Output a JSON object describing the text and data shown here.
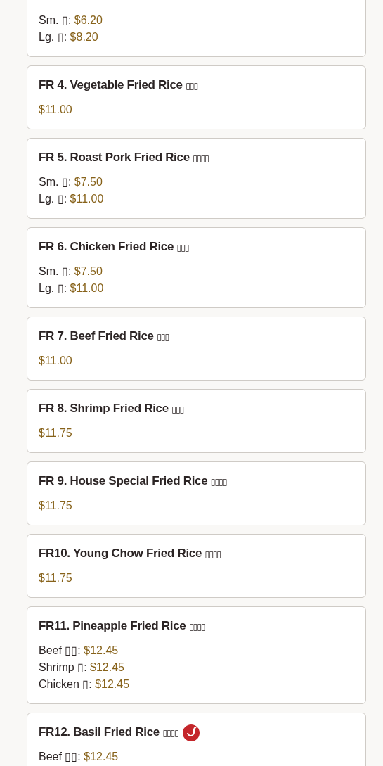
{
  "menu_items": [
    {
      "prices": [
        {
          "label": "Sm. ▯:",
          "price": "$6.20"
        },
        {
          "label": "Lg. ▯:",
          "price": "$8.20"
        }
      ]
    },
    {
      "title": "FR 4. Vegetable Fried Rice",
      "chinese": "▯▯▯",
      "spicy": false,
      "prices": [
        {
          "price": "$11.00"
        }
      ]
    },
    {
      "title": "FR 5. Roast Pork Fried Rice",
      "chinese": "▯▯▯▯",
      "spicy": false,
      "prices": [
        {
          "label": "Sm. ▯:",
          "price": "$7.50"
        },
        {
          "label": "Lg. ▯:",
          "price": "$11.00"
        }
      ]
    },
    {
      "title": "FR 6. Chicken Fried Rice",
      "chinese": "▯▯▯",
      "spicy": false,
      "prices": [
        {
          "label": "Sm. ▯:",
          "price": "$7.50"
        },
        {
          "label": "Lg. ▯:",
          "price": "$11.00"
        }
      ]
    },
    {
      "title": "FR 7. Beef Fried Rice",
      "chinese": "▯▯▯",
      "spicy": false,
      "prices": [
        {
          "price": "$11.00"
        }
      ]
    },
    {
      "title": "FR 8. Shrimp Fried Rice",
      "chinese": "▯▯▯",
      "spicy": false,
      "prices": [
        {
          "price": "$11.75"
        }
      ]
    },
    {
      "title": "FR 9. House Special Fried Rice",
      "chinese": "▯▯▯▯",
      "spicy": false,
      "prices": [
        {
          "price": "$11.75"
        }
      ]
    },
    {
      "title": "FR10. Young Chow Fried Rice",
      "chinese": "▯▯▯▯",
      "spicy": false,
      "prices": [
        {
          "price": "$11.75"
        }
      ]
    },
    {
      "title": "FR11. Pineapple Fried Rice",
      "chinese": "▯▯▯▯",
      "spicy": false,
      "prices": [
        {
          "label": "Beef ▯▯:",
          "price": "$12.45"
        },
        {
          "label": "Shrimp ▯:",
          "price": "$12.45"
        },
        {
          "label": "Chicken ▯:",
          "price": "$12.45"
        }
      ]
    },
    {
      "title": "FR12. Basil Fried Rice",
      "chinese": "▯▯▯▯",
      "spicy": true,
      "prices": [
        {
          "label": "Beef ▯▯:",
          "price": "$12.45"
        }
      ]
    }
  ]
}
